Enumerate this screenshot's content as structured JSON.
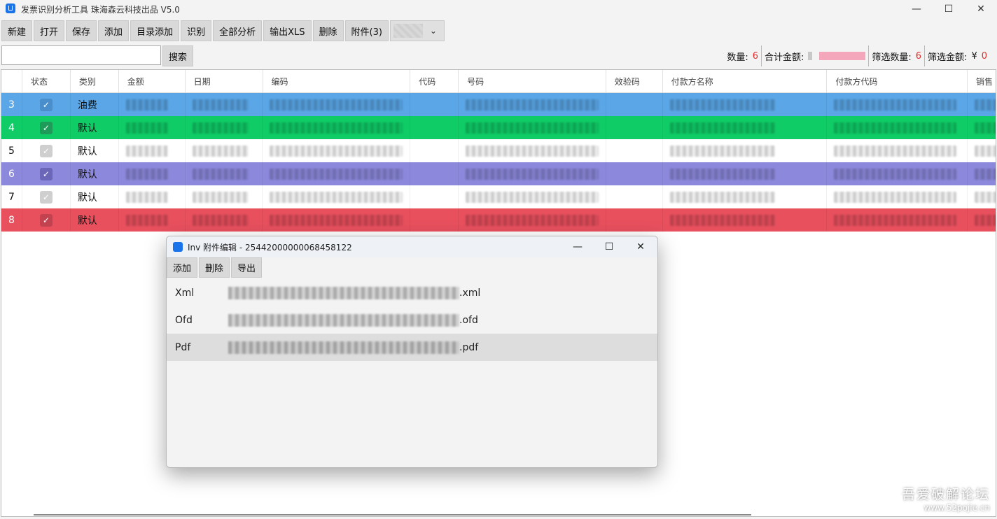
{
  "window": {
    "title": "发票识别分析工具 珠海森云科技出品 V5.0",
    "minimize": "—",
    "maximize": "☐",
    "close": "✕"
  },
  "toolbar": {
    "buttons": [
      "新建",
      "打开",
      "保存",
      "添加",
      "目录添加",
      "识别",
      "全部分析",
      "输出XLS",
      "删除",
      "附件(3)"
    ],
    "dropdown_chevron": "chevron-down-icon"
  },
  "search": {
    "placeholder": "",
    "value": "",
    "button_label": "搜索"
  },
  "stats": {
    "count_label": "数量:",
    "count_value": "6",
    "total_label": "合计金额:",
    "filter_count_label": "筛选数量:",
    "filter_count_value": "6",
    "filter_amount_label": "筛选金额:",
    "filter_amount_currency": "¥",
    "filter_amount_value": "0"
  },
  "table": {
    "columns": [
      "",
      "状态",
      "类别",
      "金额",
      "日期",
      "编码",
      "代码",
      "号码",
      "效验码",
      "付款方名称",
      "付款方代码",
      "销售"
    ],
    "rows": [
      {
        "index": "3",
        "checked": true,
        "category": "油费",
        "color": "#5aa6e6",
        "checkbox_color": "#4a8fcc"
      },
      {
        "index": "4",
        "checked": true,
        "category": "默认",
        "color": "#0fcc66",
        "checkbox_color": "#1e9b58"
      },
      {
        "index": "5",
        "checked": true,
        "category": "默认",
        "color": "#ffffff",
        "checkbox_color": "#cfcfcf"
      },
      {
        "index": "6",
        "checked": true,
        "category": "默认",
        "color": "#8c88db",
        "checkbox_color": "#6b66b8"
      },
      {
        "index": "7",
        "checked": true,
        "category": "默认",
        "color": "#ffffff",
        "checkbox_color": "#cfcfcf"
      },
      {
        "index": "8",
        "checked": true,
        "category": "默认",
        "color": "#e8505e",
        "checkbox_color": "#c24250"
      }
    ]
  },
  "dialog": {
    "title": "Inv 附件编辑 - 25442000000068458122",
    "minimize": "—",
    "maximize": "☐",
    "close": "✕",
    "buttons": [
      "添加",
      "删除",
      "导出"
    ],
    "attachments": [
      {
        "type": "Xml",
        "ext": ".xml",
        "selected": false
      },
      {
        "type": "Ofd",
        "ext": ".ofd",
        "selected": false
      },
      {
        "type": "Pdf",
        "ext": ".pdf",
        "selected": true
      }
    ]
  },
  "watermark": {
    "line1": "吾爱破解论坛",
    "line2": "www.52pojie.cn"
  }
}
